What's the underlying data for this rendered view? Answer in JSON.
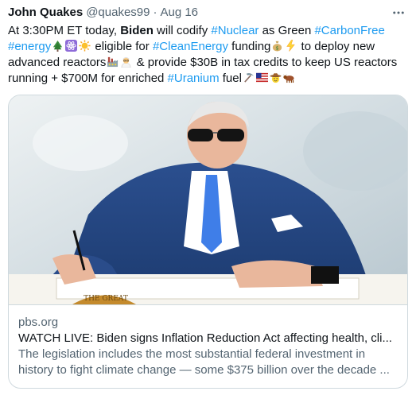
{
  "tweet": {
    "author_name": "John Quakes",
    "author_handle": "@quakes99",
    "separator": "·",
    "date": "Aug 16",
    "more_icon": "more-horizontal-icon",
    "text": {
      "l1_a": "At 3:30PM ET today, ",
      "l1_bold": "Biden",
      "l1_b": " will codify ",
      "l1_tag1": "#Nuclear",
      "l1_c": " as Green ",
      "l1_tag2": "#CarbonFree",
      "l2_tag1": "#energy",
      "l2_a": " eligible for ",
      "l2_tag2": "#CleanEnergy",
      "l2_b": " funding",
      "l2_c": " to deploy new",
      "l3_a": "advanced reactors",
      "l3_b": " & provide $30B in tax credits to keep US reactors",
      "l4_a": "running + $700M for enriched ",
      "l4_tag": "#Uranium",
      "l4_b": " fuel"
    },
    "emojis": {
      "tree": "evergreen-tree-emoji",
      "atom": "atom-symbol-emoji",
      "sun": "sun-emoji",
      "moneybag": "money-bag-emoji",
      "lightning": "high-voltage-emoji",
      "factory": "factory-emoji",
      "scientist": "scientist-emoji",
      "pick": "pick-emoji",
      "flag": "us-flag-emoji",
      "cowboy": "cowboy-emoji",
      "ox": "ox-emoji"
    },
    "colors": {
      "link": "#1d9bf0",
      "text": "#0f1419",
      "secondary": "#536471",
      "border": "#cfd9de"
    }
  },
  "card": {
    "domain": "pbs.org",
    "title": "WATCH LIVE: Biden signs Inflation Reduction Act affecting health, cli...",
    "desc_line1": "The legislation includes the most substantial federal investment in",
    "desc_line2": "history to fight climate change — some $375 billion over the decade ..."
  }
}
